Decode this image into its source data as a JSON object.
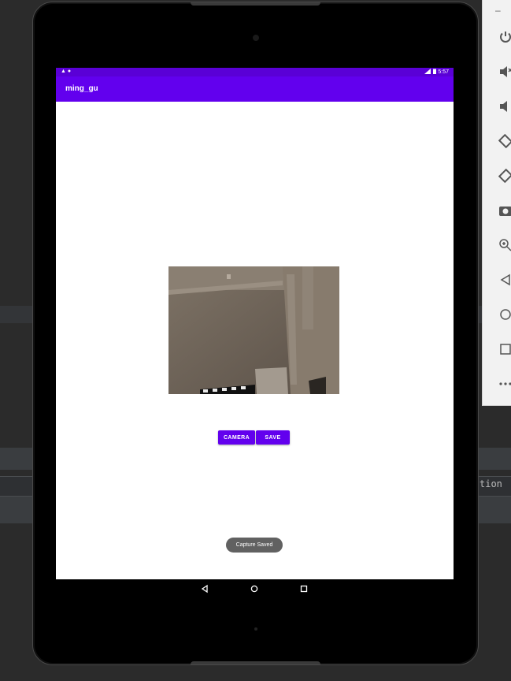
{
  "ide": {
    "partial_text": "tion"
  },
  "emulator_toolbar": {
    "minimize": "–",
    "icons": [
      "power-icon",
      "volume-up-icon",
      "volume-down-icon",
      "rotate-left-icon",
      "rotate-right-icon",
      "screenshot-icon",
      "zoom-icon",
      "back-icon",
      "home-icon",
      "overview-icon",
      "more-icon"
    ]
  },
  "status_bar": {
    "left_icons": "▲ ●",
    "time": "5:57"
  },
  "app_bar": {
    "title": "ming_gu"
  },
  "buttons": {
    "camera": "CAMERA",
    "save": "SAVE"
  },
  "toast": {
    "message": "Capture Saved"
  },
  "colors": {
    "primary": "#6200ee",
    "status_bar": "#5a00d6",
    "toast": "#616161"
  }
}
